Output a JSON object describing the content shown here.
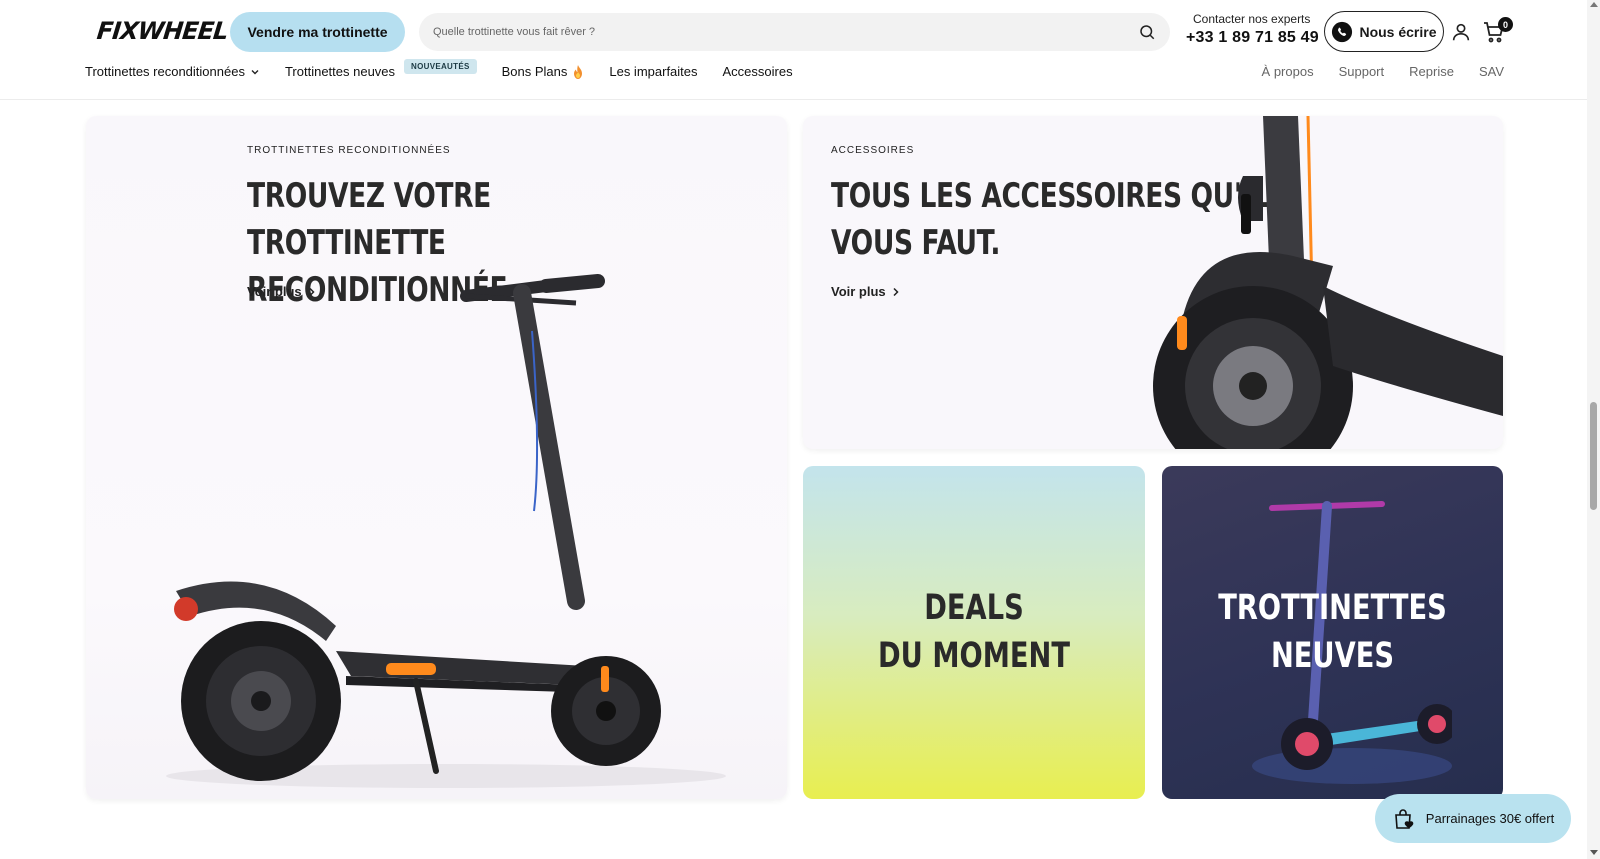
{
  "header": {
    "logo": "FIXWHEEL",
    "sell_button": "Vendre ma trottinette",
    "search_placeholder": "Quelle trottinette vous fait rêver ?",
    "contact_label": "Contacter nos experts",
    "contact_phone": "+33 1 89 71 85 49",
    "write_button": "Nous écrire",
    "cart_count": "0"
  },
  "nav": {
    "items": [
      {
        "label": "Trottinettes reconditionnées",
        "dropdown": true
      },
      {
        "label": "Trottinettes neuves",
        "badge": "NOUVEAUTÉS"
      },
      {
        "label": "Bons Plans",
        "icon": "fire-icon"
      },
      {
        "label": "Les imparfaites"
      },
      {
        "label": "Accessoires"
      }
    ],
    "secondary": [
      "À propos",
      "Support",
      "Reprise",
      "SAV"
    ]
  },
  "cards": {
    "reconditioned": {
      "eyebrow": "TROTTINETTES RECONDITIONNÉES",
      "title_line1": "TROUVEZ VOTRE TROTTINETTE",
      "title_line2": "RECONDITIONNÉE",
      "link": "Voir plus"
    },
    "accessories": {
      "eyebrow": "ACCESSOIRES",
      "title_line1": "TOUS LES ACCESSOIRES QU'IL",
      "title_line2": "VOUS FAUT.",
      "link": "Voir plus"
    },
    "deals": {
      "title_line1": "DEALS",
      "title_line2": "DU MOMENT"
    },
    "new": {
      "title_line1": "TROTTINETTES",
      "title_line2": "NEUVES"
    }
  },
  "referral": {
    "label": "Parrainages 30€ offert"
  },
  "colors": {
    "accent_blue": "#b6dff0",
    "badge_bg": "#cfe6ee",
    "deals_yellow": "#e8ee50",
    "new_card_bg": "#2f3356",
    "scooter_accent_orange": "#ff8a1c"
  }
}
